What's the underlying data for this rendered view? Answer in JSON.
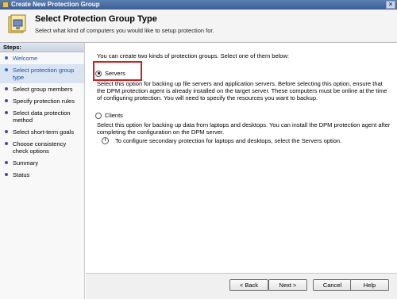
{
  "window": {
    "title": "Create New Protection Group",
    "close_glyph": "×"
  },
  "header": {
    "title": "Select Protection Group Type",
    "subtitle": "Select what kind of computers you would like to setup protection for."
  },
  "sidebar": {
    "title": "Steps:",
    "items": [
      {
        "label": "Welcome",
        "state": "visited"
      },
      {
        "label": "Select protection group type",
        "state": "current"
      },
      {
        "label": "Select group members",
        "state": "pending"
      },
      {
        "label": "Specify protection rules",
        "state": "pending"
      },
      {
        "label": "Select data protection method",
        "state": "pending"
      },
      {
        "label": "Select short-term goals",
        "state": "pending"
      },
      {
        "label": "Choose consistency check options",
        "state": "pending"
      },
      {
        "label": "Summary",
        "state": "pending"
      },
      {
        "label": "Status",
        "state": "pending"
      }
    ]
  },
  "main": {
    "intro": "You can create two kinds of protection groups. Select one of them below:",
    "options": [
      {
        "label": "Servers",
        "checked": true,
        "description": "Select this option for backing up file servers and application servers. Before selecting this option, ensure that the DPM protection agent is already installed on the target server. These computers must be online at the time of configuring protection. You will need to specify the resources you want to backup."
      },
      {
        "label": "Clients",
        "checked": false,
        "description": "Select this option for backing up data from laptops and desktops. You can install the DPM protection agent after completing the configuration on the DPM server."
      }
    ],
    "info_icon": "i",
    "info_text": "To configure secondary protection for laptops and desktops, select the Servers option."
  },
  "footer": {
    "back_label": "< Back",
    "next_label": "Next >",
    "cancel_label": "Cancel",
    "help_label": "Help"
  },
  "colors": {
    "highlight": "#d21f1f",
    "active_step": "#1b4fa8",
    "bullet": "#4a4aa6"
  }
}
